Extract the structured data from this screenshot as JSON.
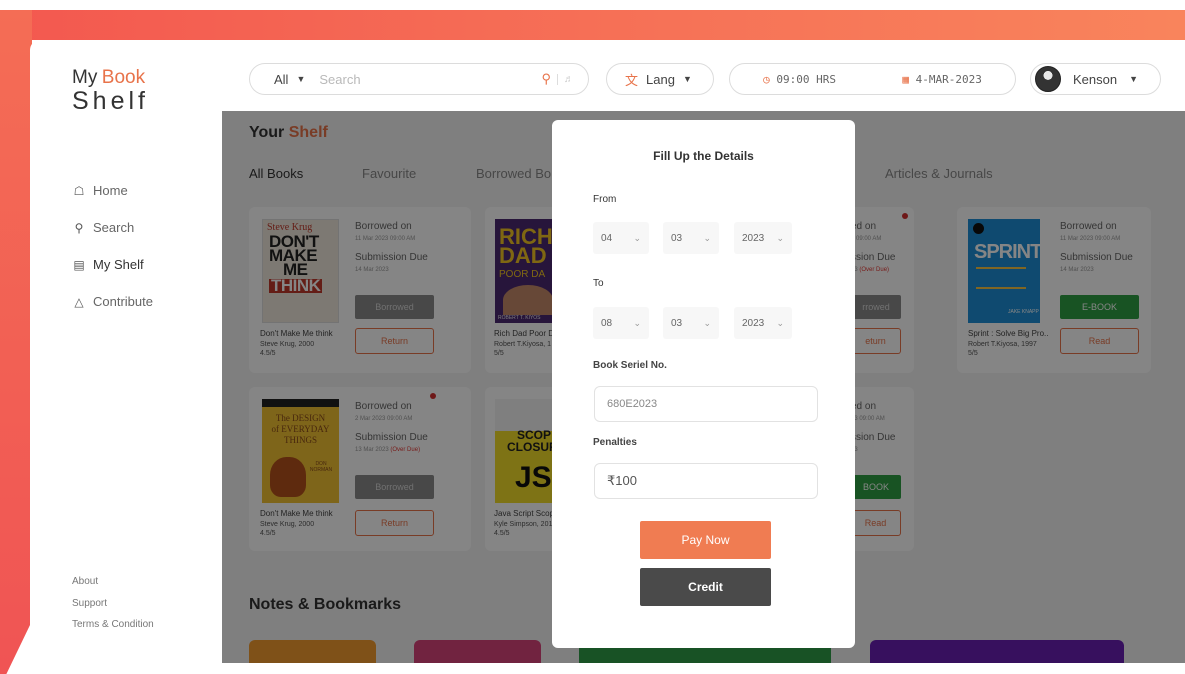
{
  "logo": {
    "my": "My",
    "book": "Book",
    "shelf": "Shelf"
  },
  "sidebar": {
    "items": [
      {
        "label": "Home",
        "icon": "home-icon"
      },
      {
        "label": "Search",
        "icon": "search-icon"
      },
      {
        "label": "My Shelf",
        "icon": "library-icon",
        "active": true
      },
      {
        "label": "Contribute",
        "icon": "contribute-icon"
      }
    ],
    "footer": [
      "About",
      "Support",
      "Terms & Condition"
    ]
  },
  "topbar": {
    "search_scope": "All",
    "search_placeholder": "Search",
    "lang_label": "Lang",
    "time": "09:00 HRS",
    "date": "4-MAR-2023",
    "user_name": "Kenson"
  },
  "main": {
    "title_prefix": "Your",
    "title_accent": "Shelf",
    "tabs": [
      "All Books",
      "Favourite",
      "Borrowed Bo",
      "Articles & Journals"
    ],
    "notes_title": "Notes & Bookmarks"
  },
  "cards": [
    {
      "cover_author": "Steve Krug",
      "cover_title": [
        "DON'T",
        "MAKE",
        "ME",
        "THINK"
      ],
      "book_title": "Don't Make Me think",
      "book_author": "Steve Krug, 2000",
      "rating": "4.5/5",
      "borrowed_label": "Borrowed on",
      "borrowed_date": "11 Mar 2023 09:00 AM",
      "due_label": "Submission Due",
      "due_date": "14 Mar 2023",
      "status": "Borrowed",
      "action": "Return"
    },
    {
      "cover_title": [
        "RICH",
        "DAD",
        "POOR DA"
      ],
      "cover_author": "ROBERT T. KIYOS",
      "book_title": "Rich Dad Poor D",
      "book_author": "Robert T.Kiyosa, 1",
      "rating": "5/5"
    },
    {
      "borrowed_label": "ed on",
      "borrowed_date": "3 09:00 AM",
      "due_label": "ssion Due",
      "due_date": "23",
      "due_note": "Over Due",
      "status": "rrowed",
      "action": "eturn"
    },
    {
      "cover_title": "SPRINT",
      "cover_author": "JAKE KNAPP",
      "book_title": "Sprint : Solve Big Pro..",
      "book_author": "Robert T.Kiyosa, 1997",
      "rating": "5/5",
      "borrowed_label": "Borrowed on",
      "borrowed_date": "11 Mar 2023 09:00 AM",
      "due_label": "Submission Due",
      "due_date": "14 Mar 2023",
      "status": "E-BOOK",
      "action": "Read"
    },
    {
      "cover_title": [
        "The DESIGN",
        "of EVERYDAY",
        "THINGS"
      ],
      "cover_author": "DON NORMAN",
      "book_title": "Don't Make Me think",
      "book_author": "Steve Krug, 2000",
      "rating": "4.5/5",
      "borrowed_label": "Borrowed on",
      "borrowed_date": "2 Mar 2023 09:00 AM",
      "due_label": "Submission Due",
      "due_date": "13 Mar 2023",
      "due_note": "Over Due",
      "status": "Borrowed",
      "action": "Return"
    },
    {
      "cover_title": [
        "SCOP",
        "CLOSUR",
        "JS"
      ],
      "book_title": "Java Script Scop",
      "book_author": "Kyle Simpson, 2014",
      "rating": "4.5/5"
    },
    {
      "borrowed_label": "ed on",
      "borrowed_date": "23 09:00 AM",
      "due_label": "ssion Due",
      "due_date": "23",
      "status": "BOOK",
      "action": "Read"
    }
  ],
  "modal": {
    "title": "Fill Up the Details",
    "from_label": "From",
    "from": {
      "day": "04",
      "month": "03",
      "year": "2023"
    },
    "to_label": "To",
    "to": {
      "day": "08",
      "month": "03",
      "year": "2023"
    },
    "serial_label": "Book Seriel No.",
    "serial_value": "680E2023",
    "penalties_label": "Penalties",
    "penalties_value": "₹100",
    "pay_label": "Pay Now",
    "credit_label": "Credit"
  },
  "colors": {
    "accent": "#e8734a",
    "overdue": "#e53935",
    "ebook": "#2ea043",
    "borrowed": "#8a8a8a",
    "note_colors": [
      "#f39b2f",
      "#d9447b",
      "#2e9d47",
      "#6a1fb5"
    ]
  }
}
